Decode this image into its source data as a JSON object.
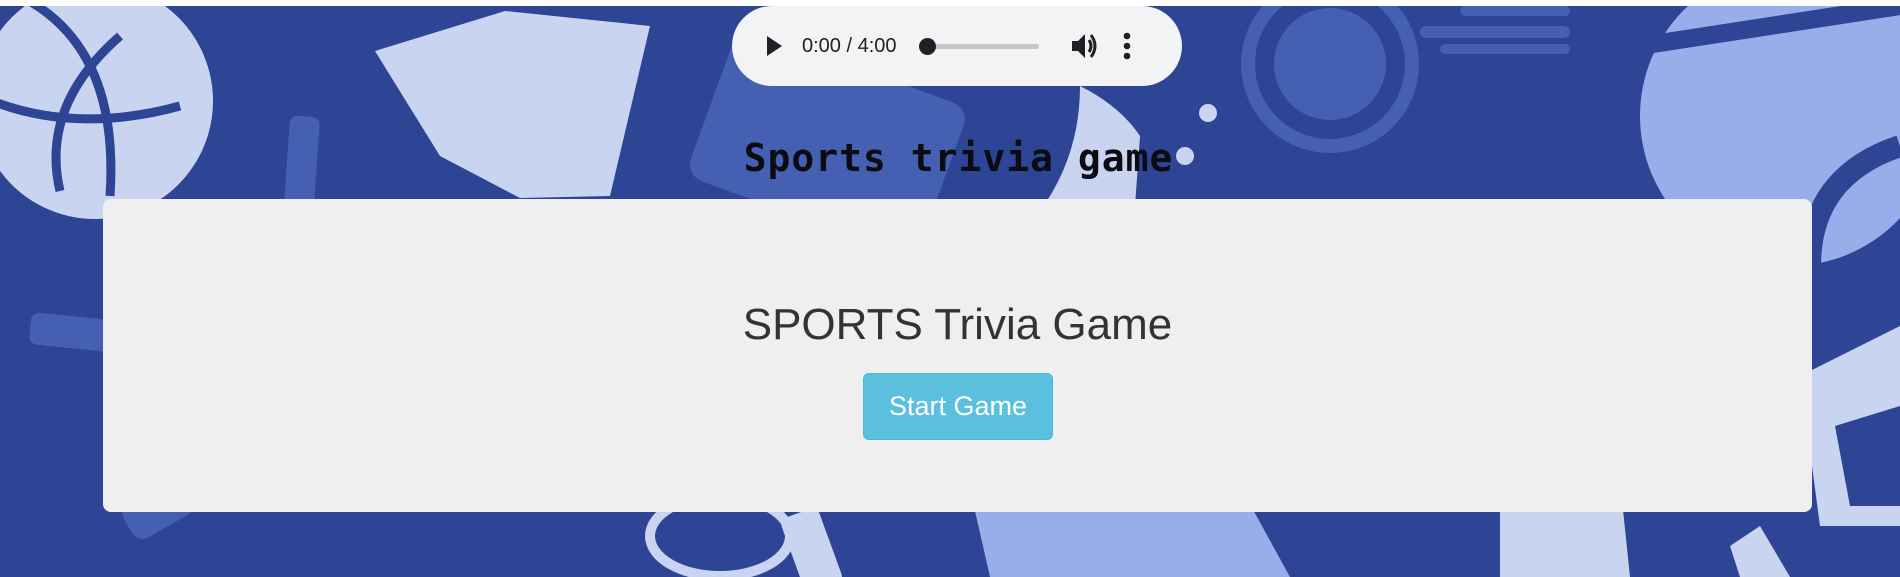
{
  "audio_player": {
    "time_display": "0:00 / 4:00",
    "progress_fraction": 0,
    "play_icon": "play-icon",
    "volume_icon": "volume-icon",
    "menu_icon": "more-vertical-icon"
  },
  "header": {
    "title": "Sports trivia game"
  },
  "game_card": {
    "title": "SPORTS Trivia Game",
    "start_button_label": "Start Game"
  },
  "background": {
    "icons": [
      "volleyball-icon",
      "basketball-icon",
      "whistle-icon",
      "stopwatch-icon",
      "badminton-icon",
      "racket-icon"
    ]
  },
  "colors": {
    "background": "#2e4494",
    "pattern_light": "#c9d5f0",
    "pattern_mid": "#4560b3",
    "card": "#efefef",
    "button": "#5bc0de",
    "player": "#f1f3f4"
  }
}
